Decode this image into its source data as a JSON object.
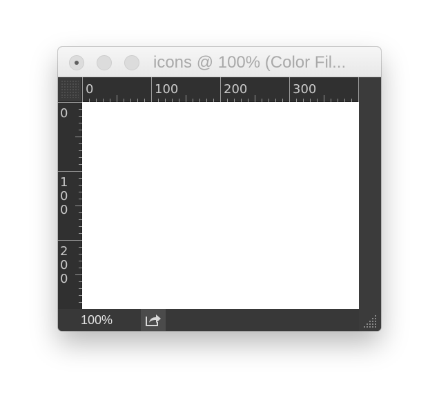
{
  "window": {
    "title": "icons @ 100% (Color Fil..."
  },
  "rulers": {
    "horizontal_labels": [
      "0",
      "100",
      "200",
      "300"
    ],
    "vertical_labels": [
      "0",
      "100",
      "200"
    ]
  },
  "statusbar": {
    "zoom": "100%"
  },
  "icons": {
    "share": "share-export-icon",
    "resize": "resize-grip-icon"
  },
  "colors": {
    "chrome_dark": "#303030",
    "canvas": "#ffffff",
    "titlebar": "#eeeeee"
  }
}
